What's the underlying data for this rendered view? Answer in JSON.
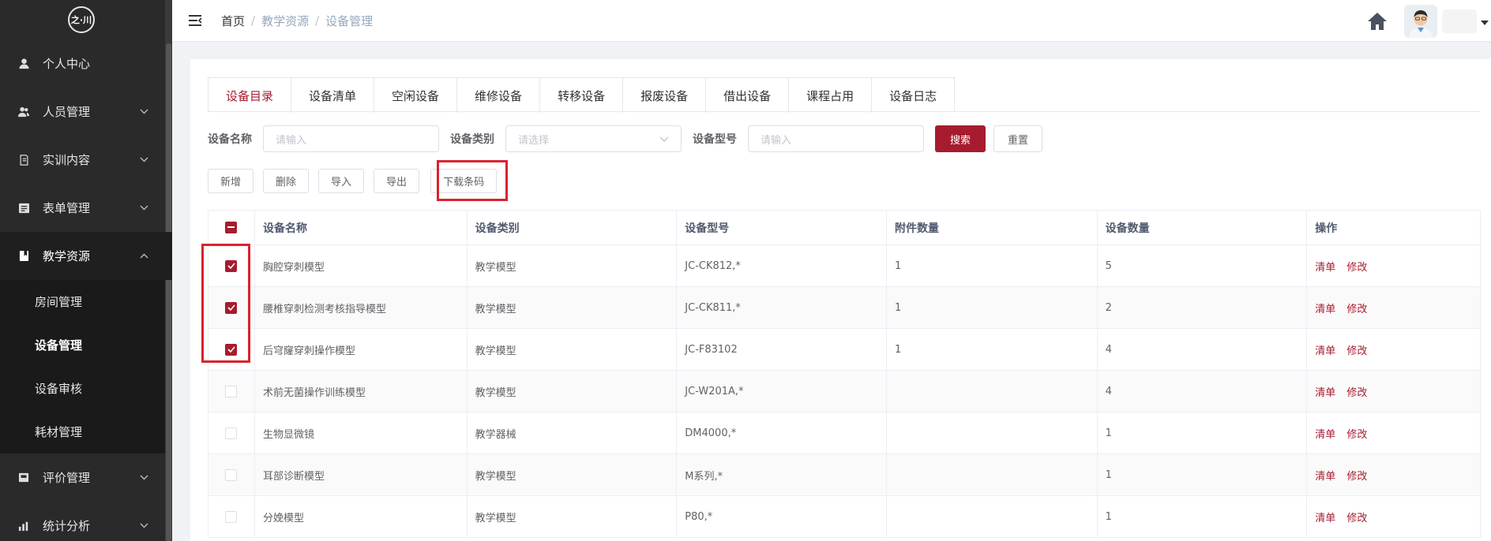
{
  "sidebar": {
    "logo_text": "之·川",
    "items": [
      {
        "label": "个人中心",
        "icon": "user-icon",
        "has_children": false
      },
      {
        "label": "人员管理",
        "icon": "users-icon",
        "has_children": true
      },
      {
        "label": "实训内容",
        "icon": "book-icon",
        "has_children": true
      },
      {
        "label": "表单管理",
        "icon": "form-icon",
        "has_children": true
      },
      {
        "label": "教学资源",
        "icon": "resource-icon",
        "has_children": true,
        "expanded": true
      }
    ],
    "sub_items": [
      {
        "label": "房间管理"
      },
      {
        "label": "设备管理",
        "active": true
      },
      {
        "label": "设备审核"
      },
      {
        "label": "耗材管理"
      }
    ],
    "bottom_items": [
      {
        "label": "评价管理",
        "icon": "evaluation-icon",
        "has_children": true
      },
      {
        "label": "统计分析",
        "icon": "chart-icon",
        "has_children": true
      }
    ]
  },
  "header": {
    "breadcrumb": [
      "首页",
      "教学资源",
      "设备管理"
    ],
    "separator": "/"
  },
  "tabs": [
    "设备目录",
    "设备清单",
    "空闲设备",
    "维修设备",
    "转移设备",
    "报废设备",
    "借出设备",
    "课程占用",
    "设备日志"
  ],
  "active_tab": 0,
  "filters": {
    "name_label": "设备名称",
    "name_placeholder": "请输入",
    "type_label": "设备类别",
    "type_placeholder": "请选择",
    "model_label": "设备型号",
    "model_placeholder": "请输入",
    "search": "搜索",
    "reset": "重置"
  },
  "toolbar": {
    "add": "新增",
    "delete": "删除",
    "import": "导入",
    "export": "导出",
    "download_barcode": "下载条码"
  },
  "table": {
    "headers": [
      "设备名称",
      "设备类别",
      "设备型号",
      "附件数量",
      "设备数量",
      "操作"
    ],
    "rows": [
      {
        "name": "胸腔穿刺模型",
        "type": "教学模型",
        "model": "JC-CK812,*",
        "attachments": "1",
        "count": "5",
        "checked": true
      },
      {
        "name": "腰椎穿刺检测考核指导模型",
        "type": "教学模型",
        "model": "JC-CK811,*",
        "attachments": "1",
        "count": "2",
        "checked": true
      },
      {
        "name": "后穹窿穿刺操作模型",
        "type": "教学模型",
        "model": "JC-F83102",
        "attachments": "1",
        "count": "4",
        "checked": true
      },
      {
        "name": "术前无菌操作训练模型",
        "type": "教学模型",
        "model": "JC-W201A,*",
        "attachments": "",
        "count": "4",
        "checked": false
      },
      {
        "name": "生物显微镜",
        "type": "教学器械",
        "model": "DM4000,*",
        "attachments": "",
        "count": "1",
        "checked": false
      },
      {
        "name": "耳部诊断模型",
        "type": "教学模型",
        "model": "M系列,*",
        "attachments": "",
        "count": "1",
        "checked": false
      },
      {
        "name": "分娩模型",
        "type": "教学模型",
        "model": "P80,*",
        "attachments": "",
        "count": "1",
        "checked": false
      }
    ],
    "action_list": "清单",
    "action_edit": "修改"
  },
  "colors": {
    "accent": "#a61c2e",
    "sidebar_bg": "#2a2a2a",
    "highlight_box": "#d9232d"
  }
}
